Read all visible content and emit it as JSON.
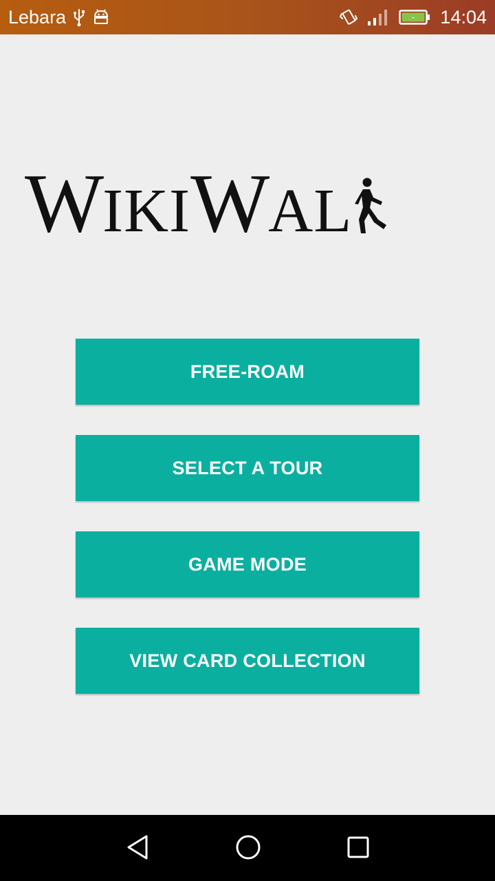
{
  "status_bar": {
    "carrier": "Lebara",
    "time": "14:04",
    "icons": [
      "usb-icon",
      "android-debug-icon",
      "vibrate-icon",
      "signal-icon",
      "battery-charging-icon"
    ],
    "color": "#a9541a"
  },
  "logo": {
    "text_part1": "W",
    "text_part2": "IKI",
    "text_part3": "W",
    "text_part4": "AL",
    "icon": "walking-person-icon"
  },
  "menu": {
    "buttons": [
      {
        "label": "FREE-ROAM"
      },
      {
        "label": "SELECT A TOUR"
      },
      {
        "label": "GAME MODE"
      },
      {
        "label": "VIEW CARD COLLECTION"
      }
    ],
    "accent_color": "#0baf9f"
  },
  "nav_bar": {
    "icons": [
      "back-icon",
      "home-icon",
      "recents-icon"
    ]
  }
}
